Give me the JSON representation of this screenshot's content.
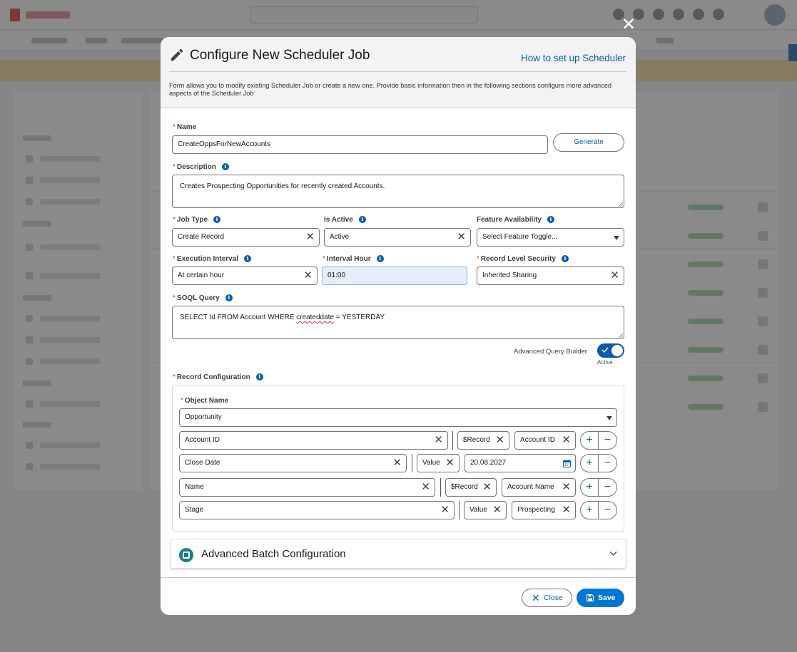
{
  "modal": {
    "title": "Configure New Scheduler Job",
    "help_link": "How to set up Scheduler",
    "description": "Form allows you to modify existing Scheduler Job or create a new one. Provide basic information then in the following sections configure more advanced aspects of the Scheduler Job",
    "close_glyph": "✕"
  },
  "form": {
    "name": {
      "label": "Name",
      "value": "CreateOppsForNewAccounts",
      "generate_label": "Generate"
    },
    "description": {
      "label": "Description",
      "value": "Creates Prospecting Opportunities for recently created Accounts."
    },
    "job_type": {
      "label": "Job Type",
      "value": "Create Record"
    },
    "is_active": {
      "label": "Is Active",
      "value": "Active"
    },
    "feature_availability": {
      "label": "Feature Availability",
      "placeholder": "Select Feature Toggle..."
    },
    "execution_interval": {
      "label": "Execution Interval",
      "value": "At certain hour"
    },
    "interval_hour": {
      "label": "Interval Hour",
      "value": "01:00"
    },
    "record_level_security": {
      "label": "Record Level Security",
      "value": "Inherited Sharing"
    },
    "soql_query": {
      "label": "SOQL Query",
      "value_before": "SELECT Id FROM Account WHERE ",
      "value_misspelled": "createddate",
      "value_after": " = YESTERDAY"
    },
    "advanced_query_builder": {
      "label": "Advanced Query Builder",
      "state": "Active",
      "on": true
    },
    "record_configuration": {
      "label": "Record Configuration",
      "object_name": {
        "label": "Object Name",
        "value": "Opportunity"
      },
      "rows": [
        {
          "field": "Account ID",
          "type": "$Record",
          "value": "Account ID"
        },
        {
          "field": "Close Date",
          "type": "Value",
          "value": "20.08.2027"
        },
        {
          "field": "Name",
          "type": "$Record",
          "value": "Account Name"
        },
        {
          "field": "Stage",
          "type": "Value",
          "value": "Prospecting"
        }
      ]
    },
    "advanced_batch": {
      "label": "Advanced Batch Configuration"
    }
  },
  "footer": {
    "close_label": "Close",
    "save_label": "Save"
  },
  "glyphs": {
    "clear": "✕",
    "plus": "+",
    "minus": "−",
    "info": "i",
    "required": "*"
  },
  "colors": {
    "brand": "#0176d3",
    "link": "#0b5cab",
    "required": "#c23934",
    "teal": "#1b7f8a"
  }
}
